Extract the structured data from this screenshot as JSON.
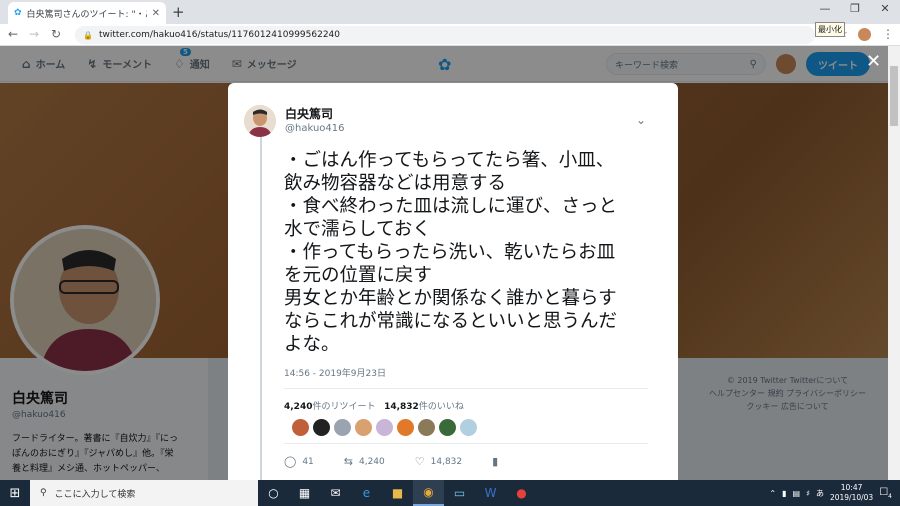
{
  "browser": {
    "tab_title": "白央篤司さんのツイート: \"・ごはん作っ",
    "url": "twitter.com/hakuo416/status/1176012410999562240",
    "tooltip": "最小化",
    "colors": {
      "tabbar": "#dee1e6",
      "twitter_blue": "#1da1f2"
    }
  },
  "twitter_nav": {
    "home": "ホーム",
    "moments": "モーメント",
    "notifications": "通知",
    "notification_count": "5",
    "messages": "メッセージ",
    "search_placeholder": "キーワード検索",
    "tweet_button": "ツイート"
  },
  "profile": {
    "name": "白央篤司",
    "handle": "@hakuo416",
    "bio": [
      "フードライター。著書に『自炊力』『にっ",
      "ぽんのおにぎり』『ジャパめし』他。『栄",
      "養と料理』メシ通、ホットペッパー、"
    ]
  },
  "footer": {
    "line1": "© 2019 Twitter  Twitterについて",
    "line2": "ヘルプセンター  規約  プライバシーポリシー",
    "line3": "クッキー  広告について"
  },
  "tweet": {
    "name": "白央篤司",
    "handle": "@hakuo416",
    "lines": [
      "・ごはん作ってもらってたら箸、小皿、",
      "飲み物容器などは用意する",
      "・食べ終わった皿は流しに運び、さっと",
      "水で濡らしておく",
      "・作ってもらったら洗い、乾いたらお皿",
      "を元の位置に戻す",
      "男女とか年齢とか関係なく誰かと暮らす",
      "ならこれが常識になるといいと思うんだ",
      "よな。"
    ],
    "timestamp": "14:56 - 2019年9月23日",
    "retweet_count": "4,240",
    "retweet_label": "件のリツイート",
    "like_count": "14,832",
    "like_label": "件のいいね",
    "likers": [
      "#c0603a",
      "#222222",
      "#9aa4b0",
      "#d9a070",
      "#c8b5d8",
      "#e07a2a",
      "#8a7a5a",
      "#3a6a3a",
      "#b0d0e0"
    ],
    "replies": "41",
    "retweets": "4,240",
    "likes": "14,832"
  },
  "taskbar": {
    "search_placeholder": "ここに入力して検索",
    "time": "10:47",
    "date": "2019/10/03",
    "ime": "あ",
    "notification_count": "4"
  }
}
